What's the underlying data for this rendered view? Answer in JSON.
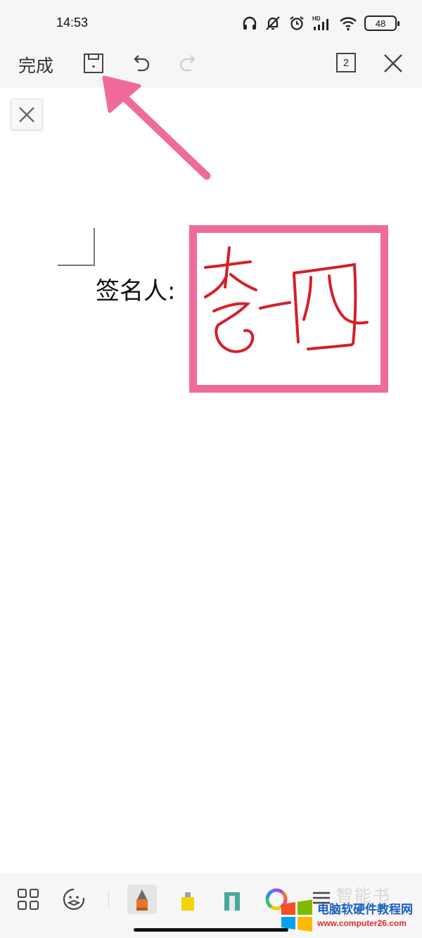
{
  "status_bar": {
    "time": "14:53",
    "battery": "48",
    "icons": [
      "headphones-icon",
      "mute-bell-icon",
      "alarm-icon",
      "hd-signal-icon",
      "wifi-icon",
      "battery-icon"
    ]
  },
  "toolbar": {
    "done_label": "完成",
    "page_count": "2",
    "icons": [
      "save-icon",
      "undo-icon",
      "redo-icon",
      "page-count-icon",
      "close-icon"
    ]
  },
  "document": {
    "signer_label": "签名人:",
    "signature_text": "李四"
  },
  "bottom_bar": {
    "tools": [
      "grid-apps-icon",
      "sticker-icon",
      "pen-icon",
      "highlighter-icon",
      "eraser-icon",
      "color-wheel-icon",
      "menu-icon"
    ],
    "selected_tool": "pen-icon",
    "ghost_text": "智能书"
  },
  "colors": {
    "annotation_pink": "#f06b9b",
    "ink_red": "#d4202a",
    "pen_tip": "#6b6b6b",
    "pen_body": "#e2762c",
    "highlighter": "#f4d400",
    "eraser": "#49a79b"
  },
  "watermark": {
    "title": "电脑软硬件教程网",
    "url": "www.computer26.com"
  }
}
